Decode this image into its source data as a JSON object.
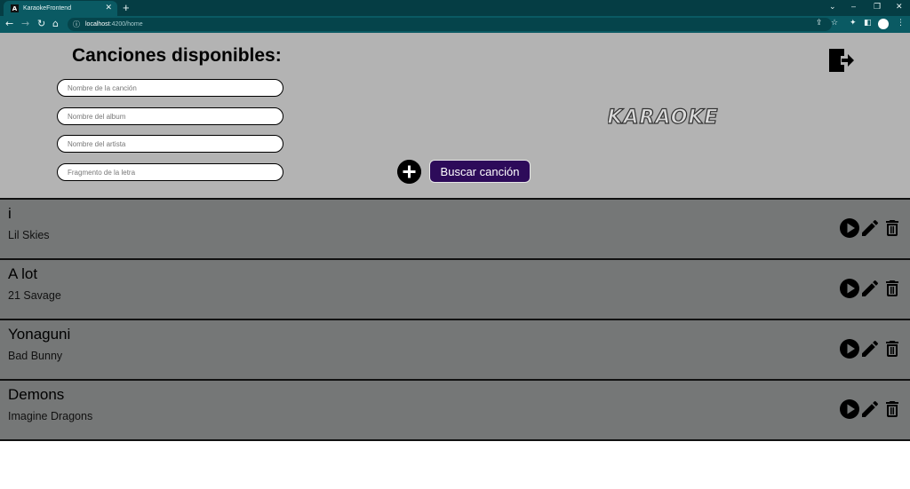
{
  "browser": {
    "tab_title": "KaraokeFrontend",
    "tab_close": "✕",
    "new_tab": "+",
    "url_host": "localhost",
    "url_path": ":4200/home",
    "controls": {
      "chevron": "⌄",
      "minimize": "–",
      "restore": "❐",
      "close": "✕"
    }
  },
  "header": {
    "title": "Canciones disponibles:",
    "inputs": {
      "song_placeholder": "Nombre de la canción",
      "album_placeholder": "Nombre del album",
      "artist_placeholder": "Nombre del artista",
      "lyrics_placeholder": "Fragmento de la letra"
    },
    "search_label": "Buscar canción",
    "logo_text": "KARAOKE"
  },
  "songs": [
    {
      "name": "i",
      "artist": "Lil Skies"
    },
    {
      "name": "A lot",
      "artist": "21 Savage"
    },
    {
      "name": "Yonaguni",
      "artist": "Bad Bunny"
    },
    {
      "name": "Demons",
      "artist": "Imagine Dragons"
    }
  ],
  "colors": {
    "browser_frame": "#053d44",
    "header_bg": "#b3b3b3",
    "row_bg": "#757777",
    "search_button": "#2d0b5a"
  },
  "icons": {
    "logout": "logout-door-icon",
    "add": "plus-circle-icon",
    "play": "play-circle-icon",
    "edit": "pencil-icon",
    "delete": "trash-icon"
  }
}
